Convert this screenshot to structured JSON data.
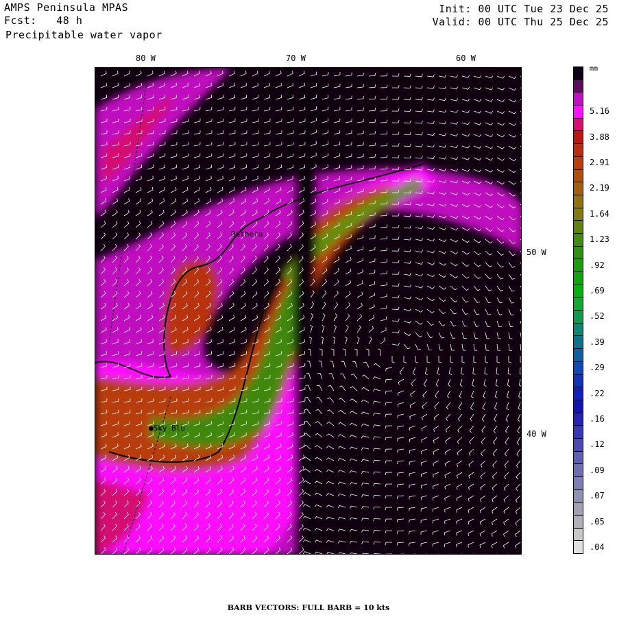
{
  "header": {
    "title": "AMPS Peninsula MPAS",
    "forecast": "Fcst:   48 h",
    "field": "Precipitable water vapor",
    "init": "Init: 00 UTC Tue 23 Dec 25",
    "valid": "Valid: 00 UTC Thu 25 Dec 25"
  },
  "axes": {
    "longitude_labels": [
      "80 W",
      "70 W",
      "60 W"
    ],
    "latitude_labels": [
      "50 W",
      "40 W"
    ]
  },
  "stations": [
    "Rothera",
    "Sky Blu"
  ],
  "colorbar": {
    "units": "mm",
    "labels": [
      "5.16",
      "3.88",
      "2.91",
      "2.19",
      "1.64",
      "1.23",
      ".92",
      ".69",
      ".52",
      ".39",
      ".29",
      ".22",
      ".16",
      ".12",
      ".09",
      ".07",
      ".05",
      ".04"
    ],
    "colors": [
      "#0c0014",
      "#5c0c5c",
      "#c010c0",
      "#ff10ff",
      "#d41070",
      "#b81810",
      "#b82c10",
      "#b83e10",
      "#ac5010",
      "#a06010",
      "#907010",
      "#807a10",
      "#608010",
      "#448a10",
      "#309010",
      "#1e9a10",
      "#10a410",
      "#00b010",
      "#10a830",
      "#109a50",
      "#108472",
      "#107286",
      "#1060a0",
      "#1048b4",
      "#1034b4",
      "#1020b8",
      "#1414b0",
      "#2424b0",
      "#3838b0",
      "#4c4cb0",
      "#6060b0",
      "#7070b0",
      "#8080b0",
      "#9090b0",
      "#a0a0b0",
      "#b0b0b8",
      "#c8c8c8",
      "#e0e0e0"
    ]
  },
  "footer": "BARB VECTORS:  FULL BARB = 10 kts"
}
